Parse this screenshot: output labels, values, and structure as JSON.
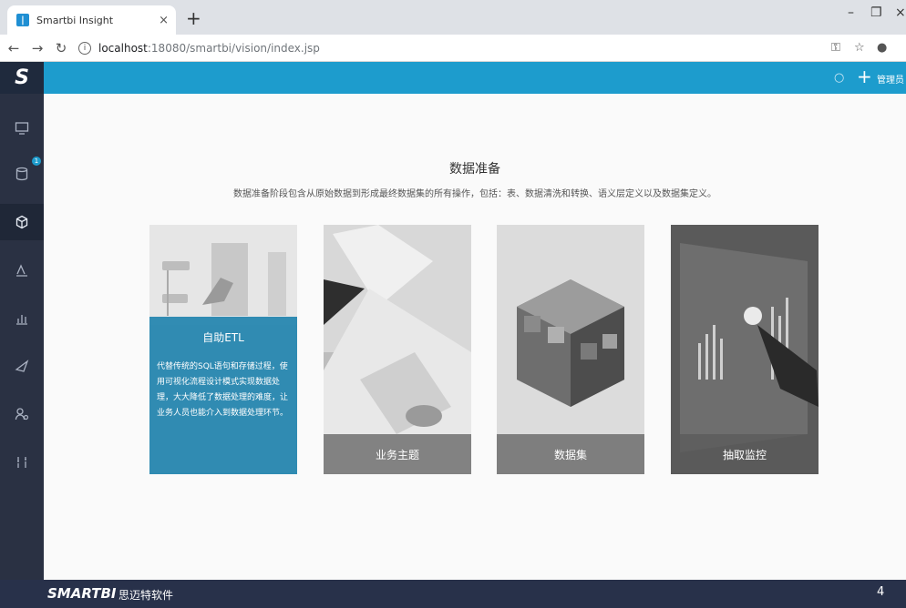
{
  "browser": {
    "tab_title": "Smartbi Insight",
    "tab_close": "×",
    "new_tab": "+",
    "url_host": "localhost",
    "url_path": ":18080/smartbi/vision/index.jsp"
  },
  "header": {
    "logo": "S",
    "user": "管理员",
    "plus": "+"
  },
  "sidebar": {
    "badge": "1",
    "items": [
      "monitor-icon",
      "database-icon",
      "cube-icon",
      "analysis-icon",
      "chart-icon",
      "send-icon",
      "people-icon",
      "tools-icon"
    ]
  },
  "main": {
    "title": "数据准备",
    "description": "数据准备阶段包含从原始数据到形成最终数据集的所有操作，包括：表、数据清洗和转换、语义层定义以及数据集定义。",
    "cards": [
      {
        "title": "自助ETL",
        "description": "代替传统的SQL语句和存储过程，使用可视化流程设计模式实现数据处理，大大降低了数据处理的难度，让业务人员也能介入到数据处理环节。"
      },
      {
        "title": "业务主题"
      },
      {
        "title": "数据集"
      },
      {
        "title": "抽取监控"
      }
    ]
  },
  "footer": {
    "brand": "SMARTBI",
    "company": "思迈特软件",
    "page_number": "4"
  },
  "colors": {
    "header": "#1d9ccd",
    "sidebar": "#2a3143",
    "etl_overlay": "#1880ac"
  }
}
